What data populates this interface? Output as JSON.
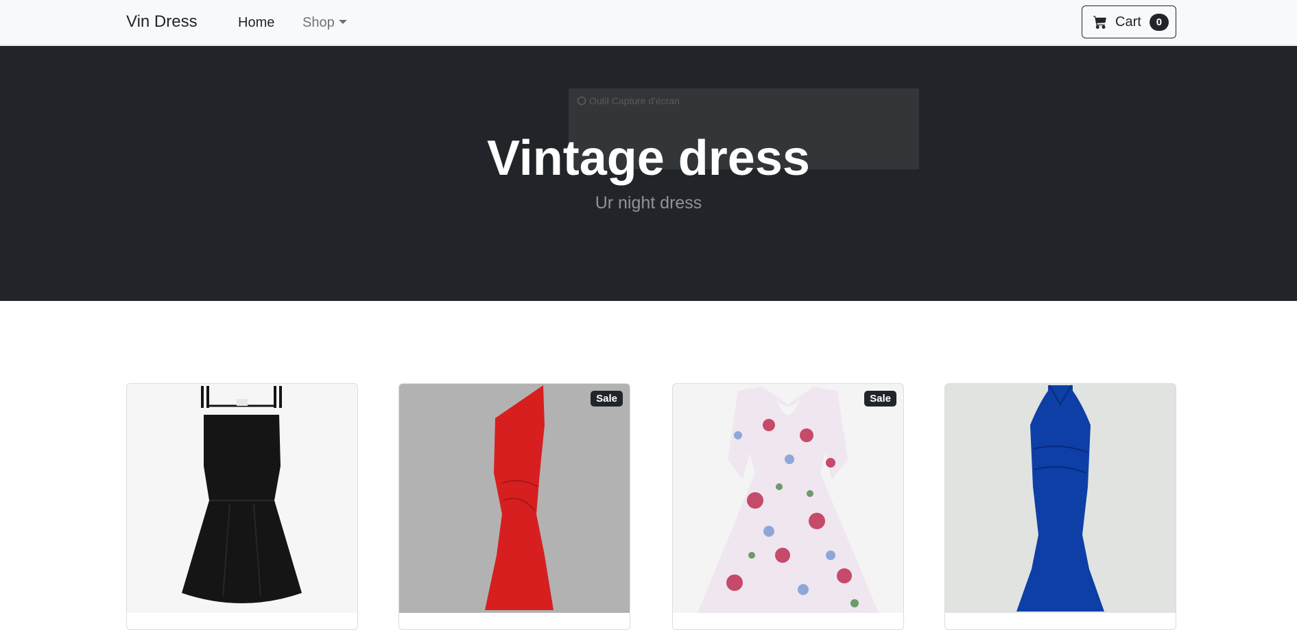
{
  "navbar": {
    "brand": "Vin Dress",
    "links": [
      {
        "label": "Home",
        "active": true
      },
      {
        "label": "Shop",
        "dropdown": true
      }
    ],
    "cart": {
      "label": "Cart",
      "count": "0",
      "icon": "cart-icon"
    }
  },
  "hero": {
    "title": "Vintage dress",
    "subtitle": "Ur night dress",
    "background": "#212529",
    "overlay_label": "Outil Capture d'écran"
  },
  "products": [
    {
      "name": "black-dress",
      "color": "#151515",
      "bg": "#f6f6f6",
      "sale": false
    },
    {
      "name": "red-dress",
      "color": "#d71f1f",
      "bg": "#b2b2b2",
      "sale": true,
      "badge": "Sale"
    },
    {
      "name": "floral-dress",
      "color": "#c86b86",
      "bg": "#f4f4f4",
      "sale": true,
      "badge": "Sale"
    },
    {
      "name": "blue-dress",
      "color": "#0d3fa6",
      "bg": "#e1e3e1",
      "sale": false
    }
  ]
}
